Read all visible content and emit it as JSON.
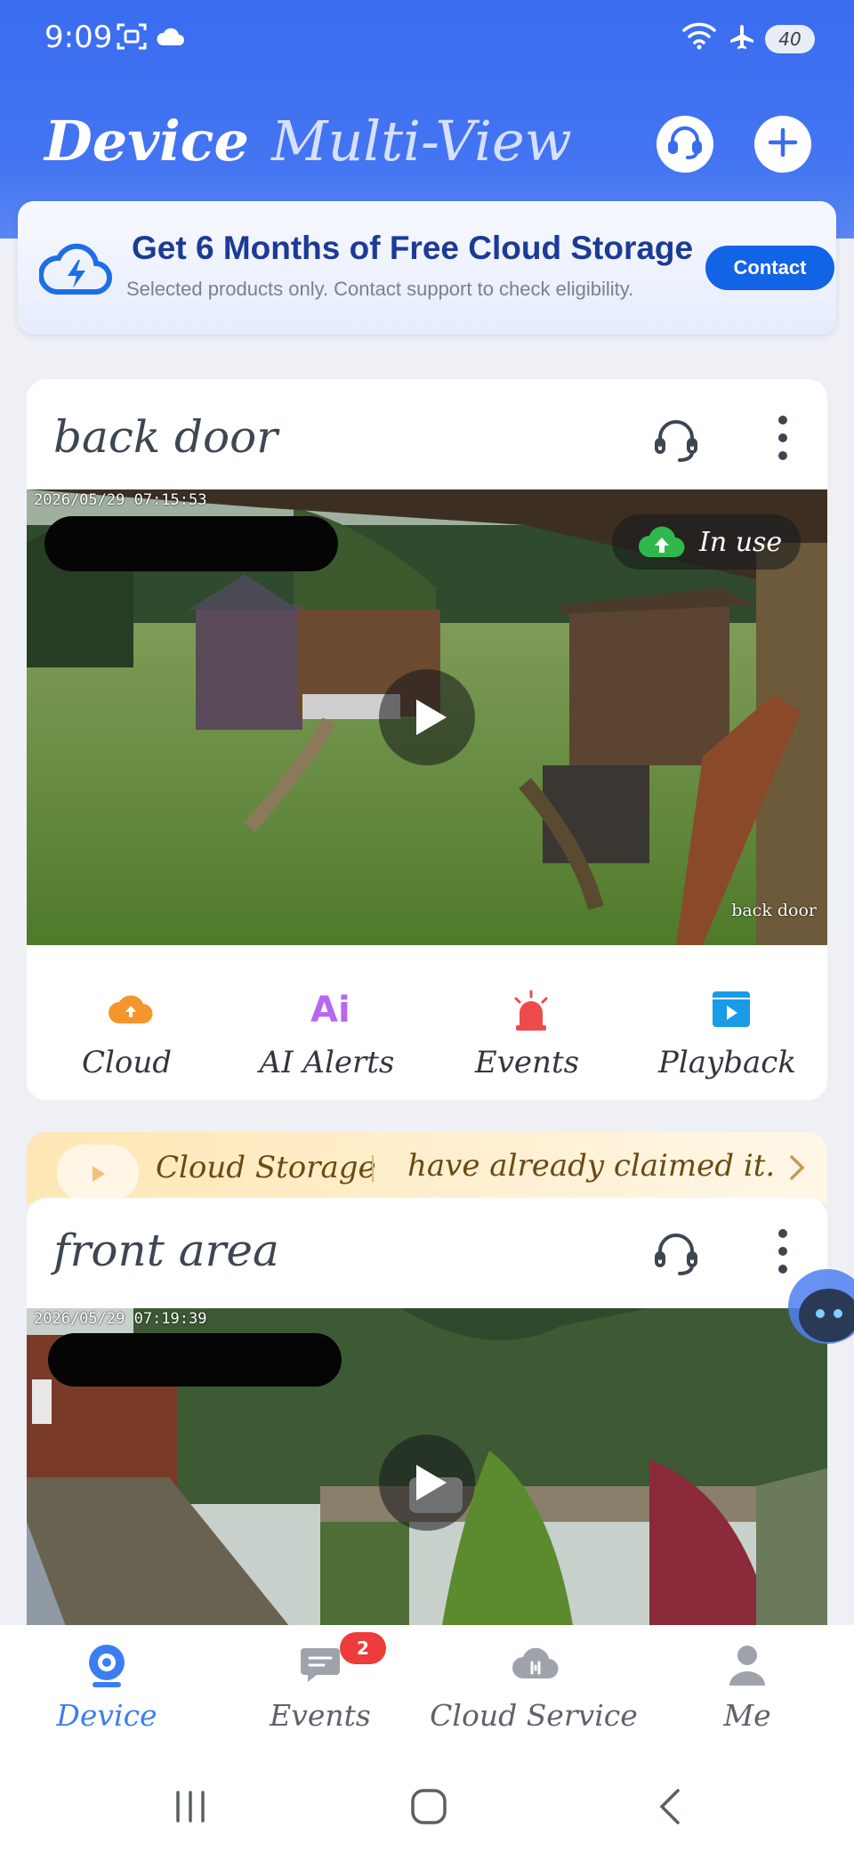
{
  "status_bar": {
    "time": "9:09",
    "battery": "40",
    "icons": [
      "screenshot-icon",
      "cloud-icon",
      "wifi-icon",
      "airplane-icon",
      "battery-icon"
    ]
  },
  "header": {
    "tabs": [
      {
        "label": "Device",
        "active": true
      },
      {
        "label": "Multi-View",
        "active": false
      }
    ],
    "support_icon": "headset-icon",
    "add_icon": "plus-icon"
  },
  "promo": {
    "title": "Get 6 Months of Free Cloud Storage",
    "subtitle": "Selected products only. Contact support to check eligibility.",
    "button": "Contact",
    "icon": "cloud-lightning-icon"
  },
  "devices": [
    {
      "name": "back door",
      "timestamp": "2026/05/29 07:15:53",
      "feed_label": "back door",
      "in_use_label": "In use",
      "actions": [
        {
          "label": "Cloud",
          "icon": "cloud-upload-icon",
          "color": "#f5962d"
        },
        {
          "label": "AI Alerts",
          "icon": "ai-icon",
          "color": "#b768f0"
        },
        {
          "label": "Events",
          "icon": "siren-icon",
          "color": "#ef4a4a"
        },
        {
          "label": "Playback",
          "icon": "video-play-icon",
          "color": "#1a9be8"
        }
      ]
    },
    {
      "name": "front area",
      "timestamp": "2026/05/29 07:19:39"
    }
  ],
  "cloud_strip": {
    "title": "Cloud Storage",
    "text": "have already claimed it."
  },
  "bottom_nav": [
    {
      "label": "Device",
      "icon": "camera-icon",
      "active": true
    },
    {
      "label": "Events",
      "icon": "message-icon",
      "badge": "2",
      "active": false
    },
    {
      "label": "Cloud Service",
      "icon": "cloud-service-icon",
      "active": false
    },
    {
      "label": "Me",
      "icon": "person-icon",
      "active": false
    }
  ],
  "colors": {
    "header_blue": "#3a6cf0",
    "accent_blue": "#3c7ef2",
    "badge_red": "#ee3b3b"
  }
}
